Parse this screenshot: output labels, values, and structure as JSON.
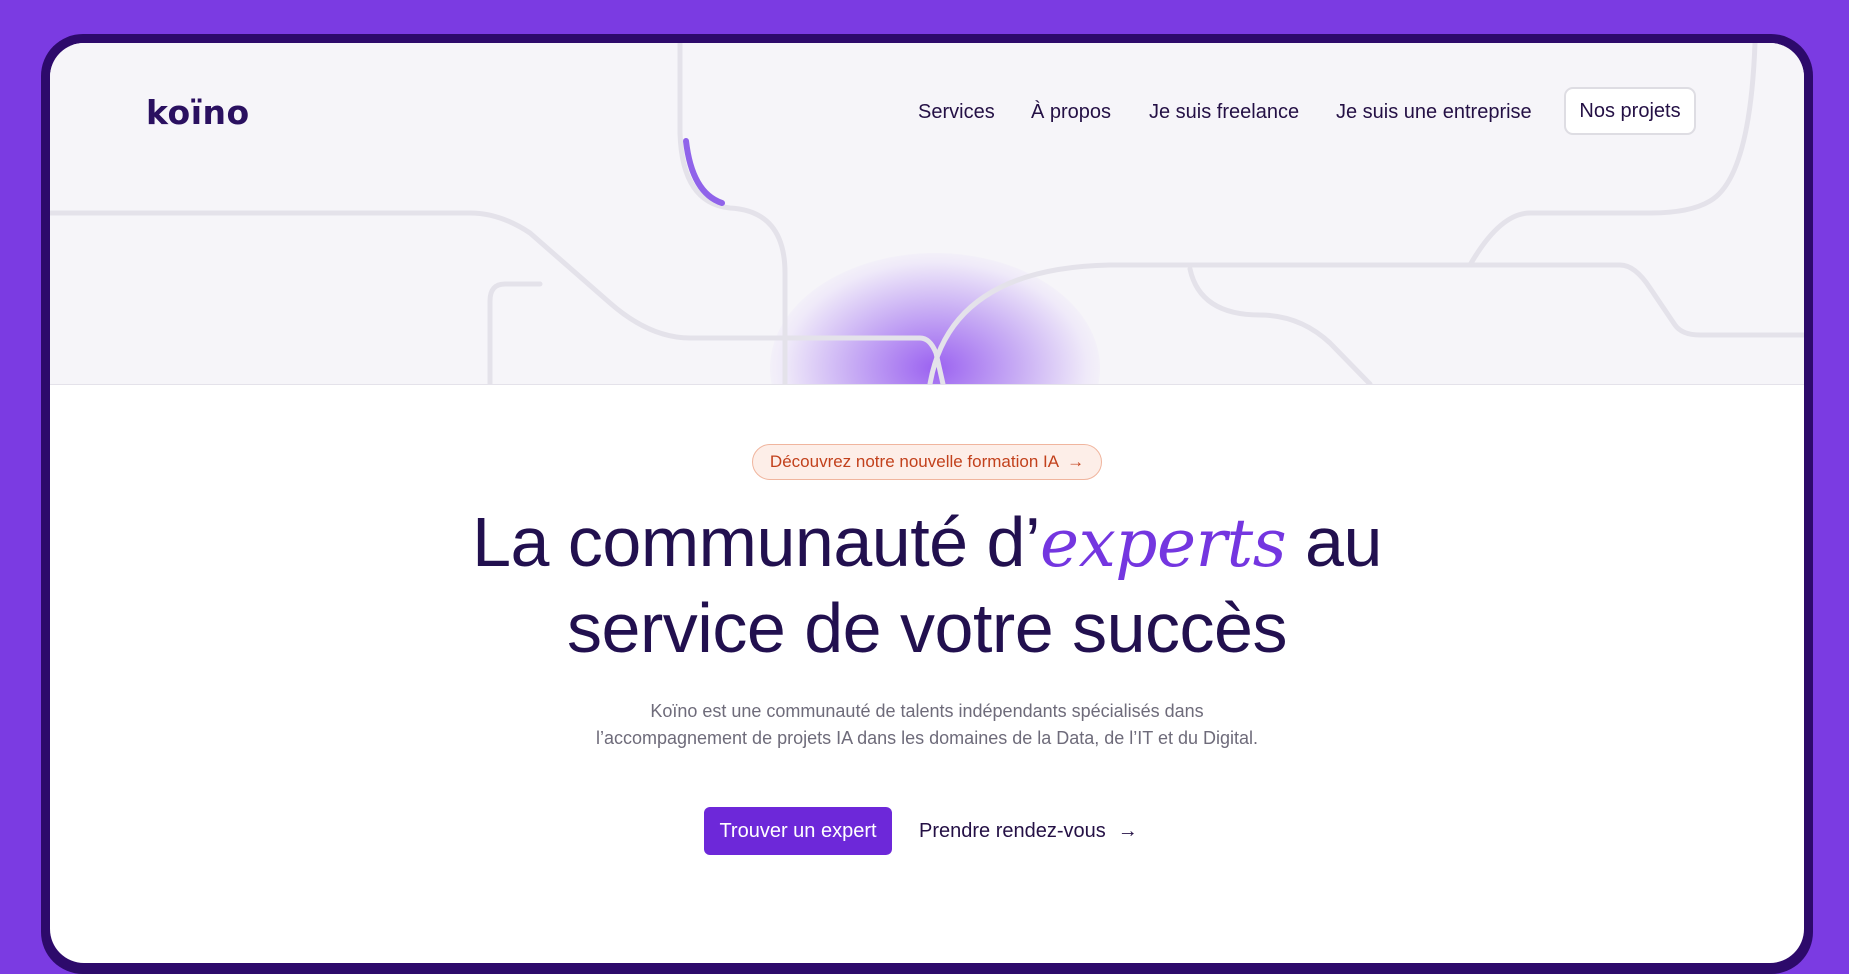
{
  "brand": {
    "logo_text": "koïno"
  },
  "nav": {
    "links": [
      "Services",
      "À propos",
      "Je suis freelance",
      "Je suis une entreprise"
    ],
    "cta_label": "Nos projets"
  },
  "promo": {
    "label": "Découvrez notre nouvelle formation IA",
    "arrow": "→"
  },
  "hero": {
    "title_line1_start": "La communauté d’",
    "title_line1_emphasis": "experts",
    "title_line1_end": " au",
    "title_line2": "service de votre succès",
    "subtitle_line1": "Koïno est une communauté de talents indépendants spécialisés dans",
    "subtitle_line2": "l’accompagnement de projets IA dans les domaines de la Data, de l’IT et du Digital."
  },
  "actions": {
    "primary_label": "Trouver un expert",
    "secondary_label": "Prendre rendez-vous",
    "secondary_arrow": "→"
  },
  "colors": {
    "outer_background": "#7b3be2",
    "accent": "#6d28d9",
    "emphasis": "#7436e0",
    "text_dark": "#22104f",
    "promo_text": "#c2411c"
  }
}
